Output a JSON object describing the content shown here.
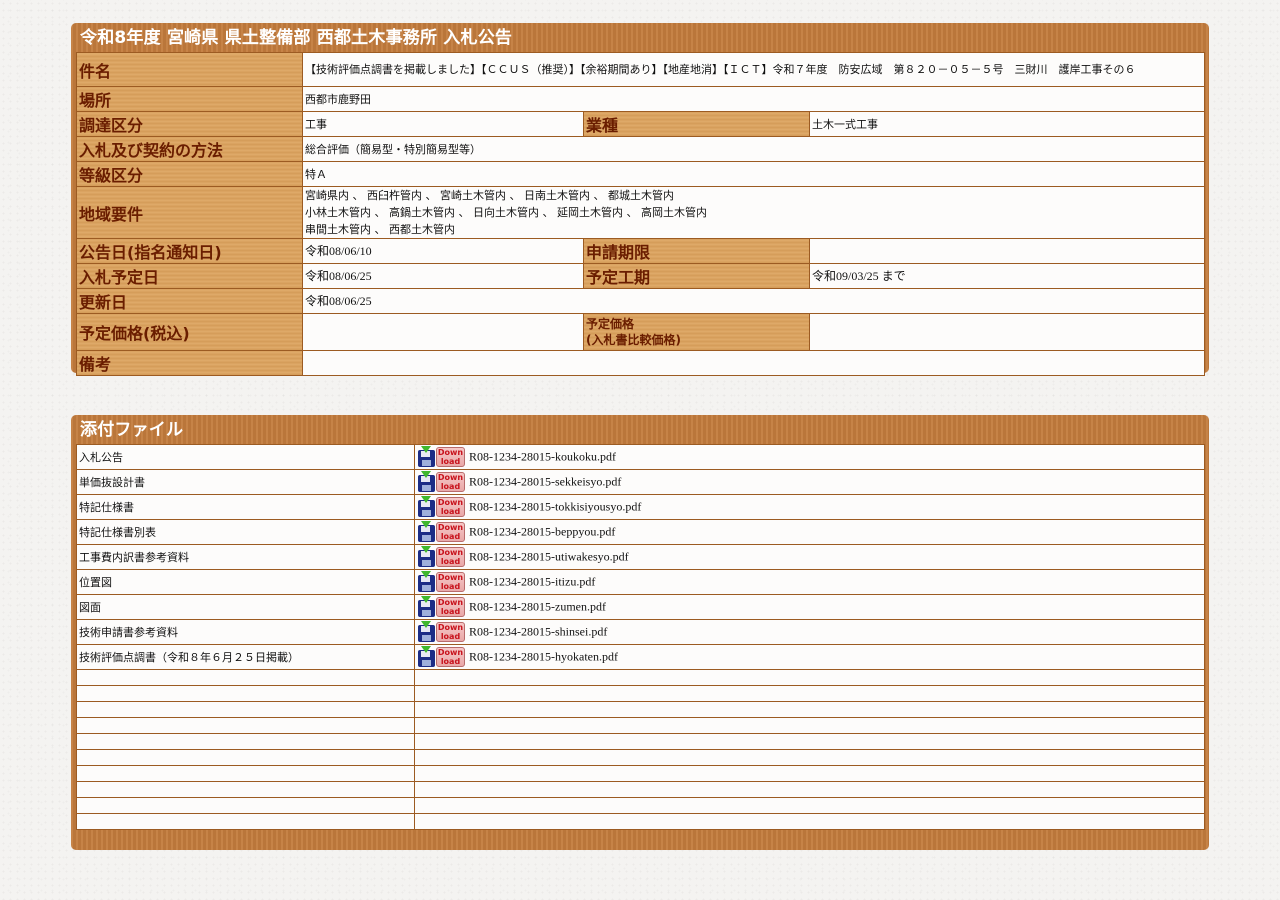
{
  "notice": {
    "title": "令和8年度 宮崎県 県土整備部 西都土木事務所 入札公告",
    "labels": {
      "subject": "件名",
      "location": "場所",
      "procurement": "調達区分",
      "industry": "業種",
      "method": "入札及び契約の方法",
      "grade": "等級区分",
      "region": "地域要件",
      "announce_date": "公告日(指名通知日)",
      "application_deadline": "申請期限",
      "bid_date": "入札予定日",
      "construction_period": "予定工期",
      "update_date": "更新日",
      "planned_price": "予定価格(税込)",
      "planned_price_compare_1": "予定価格",
      "planned_price_compare_2": "(入札書比較価格)",
      "remarks": "備考"
    },
    "values": {
      "subject": "【技術評価点調書を掲載しました】【ＣＣＵＳ（推奨）】【余裕期間あり】【地産地消】【ＩＣＴ】令和７年度　防安広域　第８２０－０５－５号　三財川　護岸工事その６",
      "location": "西都市鹿野田",
      "procurement": "工事",
      "industry": "土木一式工事",
      "method": "総合評価（簡易型・特別簡易型等）",
      "grade": "特Ａ",
      "region_lines": [
        "宮崎県内 、 西臼杵管内 、 宮崎土木管内 、 日南土木管内 、 都城土木管内",
        "小林土木管内 、 高鍋土木管内 、 日向土木管内 、 延岡土木管内 、 高岡土木管内",
        "串間土木管内 、 西都土木管内"
      ],
      "announce_date": "令和08/06/10",
      "application_deadline": "",
      "bid_date": "令和08/06/25",
      "construction_period": "令和09/03/25 まで",
      "update_date": "令和08/06/25",
      "planned_price": "",
      "planned_price_compare": "",
      "remarks": ""
    }
  },
  "attachments": {
    "title": "添付ファイル",
    "download_icon_text_1": "Down",
    "download_icon_text_2": "load",
    "files": [
      {
        "label": "入札公告",
        "filename": "R08-1234-28015-koukoku.pdf"
      },
      {
        "label": "単価抜設計書",
        "filename": "R08-1234-28015-sekkeisyo.pdf"
      },
      {
        "label": "特記仕様書",
        "filename": "R08-1234-28015-tokkisiyousyo.pdf"
      },
      {
        "label": "特記仕様書別表",
        "filename": "R08-1234-28015-beppyou.pdf"
      },
      {
        "label": "工事費内訳書参考資料",
        "filename": "R08-1234-28015-utiwakesyo.pdf"
      },
      {
        "label": "位置図",
        "filename": "R08-1234-28015-itizu.pdf"
      },
      {
        "label": "図面",
        "filename": "R08-1234-28015-zumen.pdf"
      },
      {
        "label": "技術申請書参考資料",
        "filename": "R08-1234-28015-shinsei.pdf"
      },
      {
        "label": "技術評価点調書（令和８年６月２５日掲載）",
        "filename": "R08-1234-28015-hyokaten.pdf"
      }
    ]
  }
}
